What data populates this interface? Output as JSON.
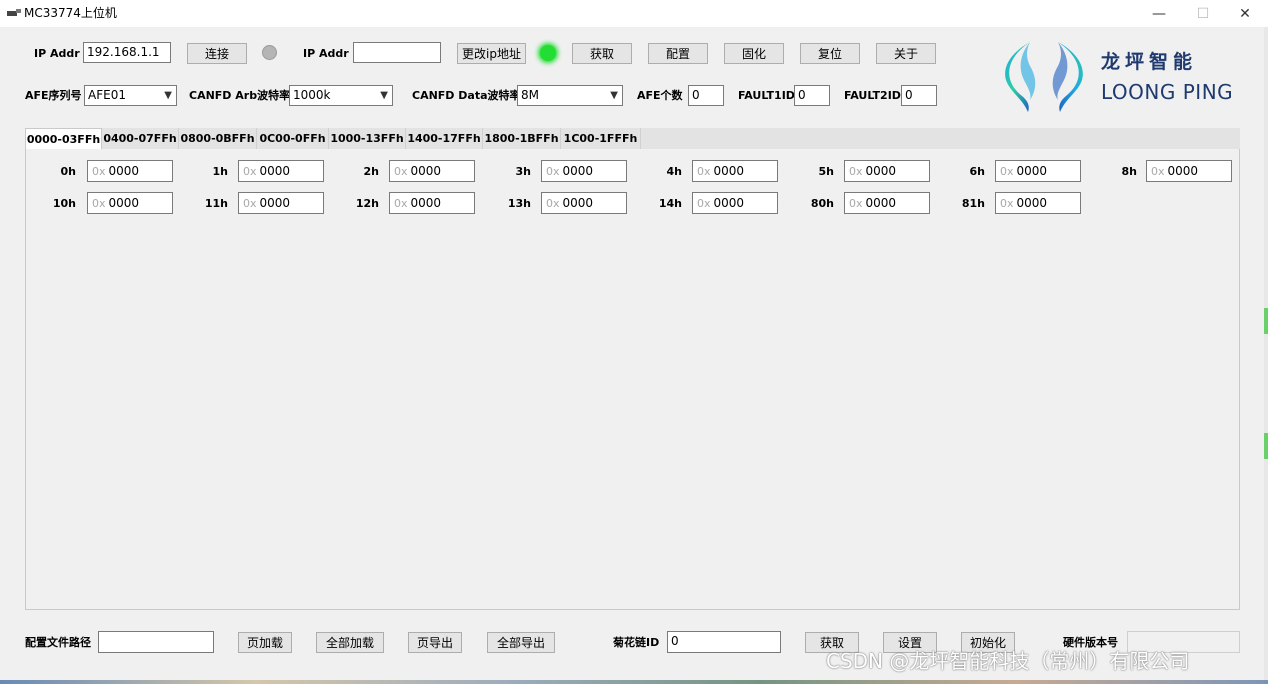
{
  "window": {
    "title": "MC33774上位机",
    "min_glyph": "—",
    "max_glyph": "☐",
    "close_glyph": "✕"
  },
  "toolbar": {
    "ip_label": "IP Addr",
    "ip_value": "192.168.1.1",
    "connect_label": "连接",
    "ip2_label": "IP Addr",
    "ip2_value": "",
    "change_ip_label": "更改ip地址",
    "get_label": "获取",
    "config_label": "配置",
    "solidify_label": "固化",
    "reset_label": "复位",
    "about_label": "关于",
    "connect_led_color": "#b5b5b5",
    "status_led_color": "#22dd33"
  },
  "row2": {
    "afe_seq_label": "AFE序列号",
    "afe_seq_value": "AFE01",
    "canfd_arb_label": "CANFD Arb波特率",
    "canfd_arb_value": "1000k",
    "canfd_data_label": "CANFD Data波特率",
    "canfd_data_value": "8M",
    "afe_count_label": "AFE个数",
    "afe_count_value": "0",
    "fault1_label": "FAULT1ID",
    "fault1_value": "0",
    "fault2_label": "FAULT2ID",
    "fault2_value": "0"
  },
  "logo": {
    "cn": "龙坪智能",
    "en": "LOONG PING",
    "color": "#1f3a6f",
    "accent_colors": [
      "#1ea8e0",
      "#2ecfa5",
      "#1e5fc0"
    ]
  },
  "tabs": [
    {
      "label": "0000-03FFh",
      "active": true
    },
    {
      "label": "0400-07FFh",
      "active": false
    },
    {
      "label": "0800-0BFFh",
      "active": false
    },
    {
      "label": "0C00-0FFh",
      "active": false
    },
    {
      "label": "1000-13FFh",
      "active": false
    },
    {
      "label": "1400-17FFh",
      "active": false
    },
    {
      "label": "1800-1BFFh",
      "active": false
    },
    {
      "label": "1C00-1FFFh",
      "active": false
    }
  ],
  "registers": {
    "prefix": "0x",
    "row1": [
      {
        "label": "0h",
        "value": "0000"
      },
      {
        "label": "1h",
        "value": "0000"
      },
      {
        "label": "2h",
        "value": "0000"
      },
      {
        "label": "3h",
        "value": "0000"
      },
      {
        "label": "4h",
        "value": "0000"
      },
      {
        "label": "5h",
        "value": "0000"
      },
      {
        "label": "6h",
        "value": "0000"
      },
      {
        "label": "8h",
        "value": "0000"
      }
    ],
    "row2": [
      {
        "label": "10h",
        "value": "0000"
      },
      {
        "label": "11h",
        "value": "0000"
      },
      {
        "label": "12h",
        "value": "0000"
      },
      {
        "label": "13h",
        "value": "0000"
      },
      {
        "label": "14h",
        "value": "0000"
      },
      {
        "label": "80h",
        "value": "0000"
      },
      {
        "label": "81h",
        "value": "0000"
      }
    ]
  },
  "bottom": {
    "config_path_label": "配置文件路径",
    "config_path_value": "",
    "page_load_label": "页加载",
    "load_all_label": "全部加载",
    "page_export_label": "页导出",
    "export_all_label": "全部导出",
    "daisy_id_label": "菊花链ID",
    "daisy_id_value": "0",
    "get_label": "获取",
    "set_label": "设置",
    "init_label": "初始化",
    "hw_version_label": "硬件版本号",
    "hw_version_value": ""
  },
  "watermark": "CSDN @龙坪智能科技（常州）有限公司"
}
